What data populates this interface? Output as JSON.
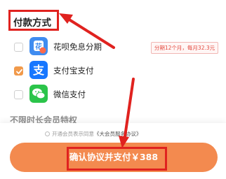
{
  "header": {
    "title": "付款方式"
  },
  "payment_methods": [
    {
      "label": "花呗免息分期",
      "icon": "huabei-icon",
      "color": "#3f8cf0",
      "checked": false,
      "promo": "分期12个月，每月32.3元"
    },
    {
      "label": "支付宝支付",
      "icon": "alipay-icon",
      "color": "#1677ff",
      "checked": true
    },
    {
      "label": "微信支付",
      "icon": "wechat-icon",
      "color": "#2bc44a",
      "checked": false
    }
  ],
  "section": {
    "title": "不限时长会员特权"
  },
  "agreement": {
    "prefix": "开通会员表示同意",
    "link": "《大会员服务协议》"
  },
  "pay_button": {
    "label": "确认协议并支付￥388"
  },
  "colors": {
    "accent": "#f38a4f",
    "annotation_red": "#e0221f",
    "check": "#f19a4b"
  }
}
